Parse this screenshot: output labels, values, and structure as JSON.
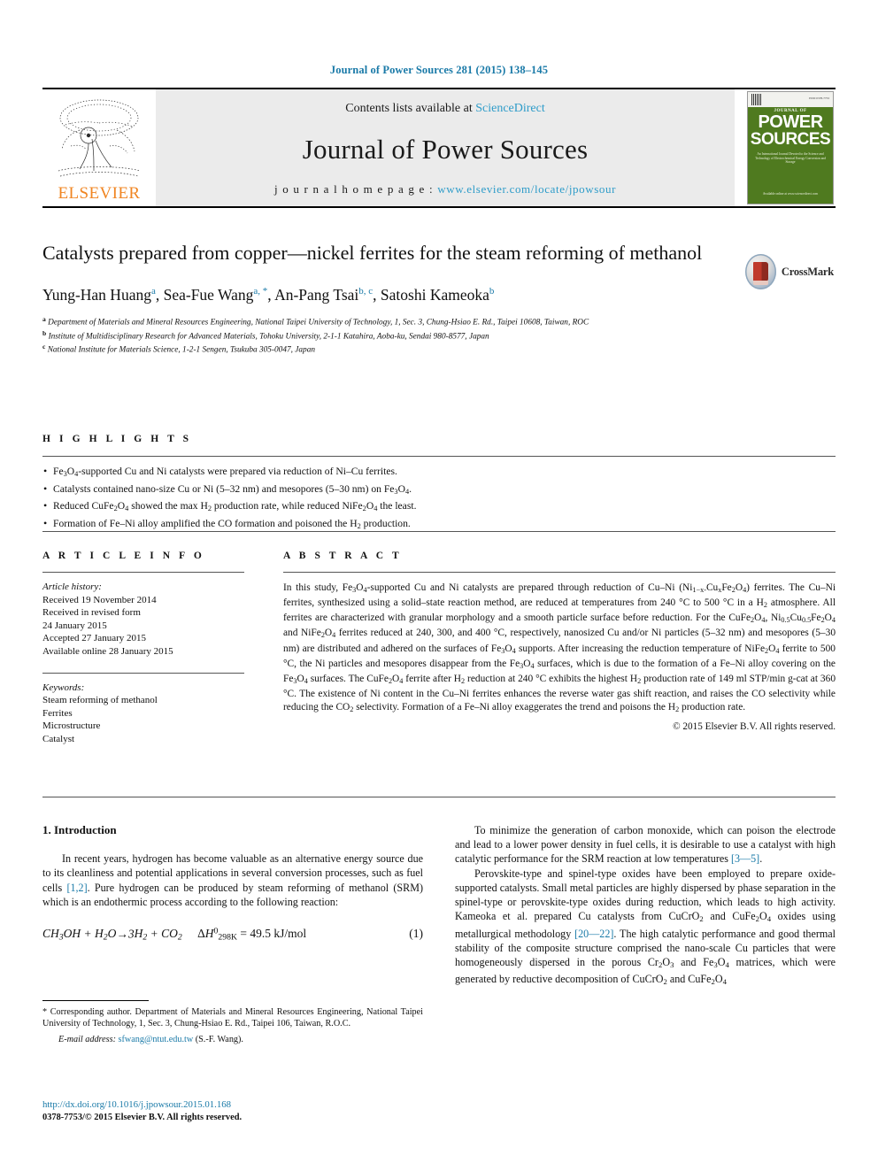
{
  "running_head": "Journal of Power Sources 281 (2015) 138–145",
  "masthead": {
    "contents_prefix": "Contents lists available at ",
    "sciencedirect": "ScienceDirect",
    "journal_name": "Journal of Power Sources",
    "homepage_label": "j o u r n a l   h o m e p a g e :   ",
    "homepage_url": "www.elsevier.com/locate/jpowsour",
    "publisher": "ELSEVIER",
    "cover": {
      "journal_of": "JOURNAL OF",
      "power": "POWER",
      "sources": "SOURCES",
      "blurb": "An International Journal Devoted to the Science and Technology of Electrochemical Energy Conversion and Storage",
      "foot": "Available online at www.sciencedirect.com"
    }
  },
  "article": {
    "title": "Catalysts prepared from copper—nickel ferrites for the steam reforming of methanol",
    "crossmark_label": "CrossMark",
    "authors": [
      {
        "name": "Yung-Han Huang",
        "marks": "a"
      },
      {
        "name": "Sea-Fue Wang",
        "marks": "a, *"
      },
      {
        "name": "An-Pang Tsai",
        "marks": "b, c"
      },
      {
        "name": "Satoshi Kameoka",
        "marks": "b"
      }
    ],
    "affiliations": [
      {
        "mark": "a",
        "text": "Department of Materials and Mineral Resources Engineering, National Taipei University of Technology, 1, Sec. 3, Chung-Hsiao E. Rd., Taipei 10608, Taiwan, ROC"
      },
      {
        "mark": "b",
        "text": "Institute of Multidisciplinary Research for Advanced Materials, Tohoku University, 2-1-1 Katahira, Aoba-ku, Sendai 980-8577, Japan"
      },
      {
        "mark": "c",
        "text": "National Institute for Materials Science, 1-2-1 Sengen, Tsukuba 305-0047, Japan"
      }
    ]
  },
  "highlights": {
    "heading": "H I G H L I G H T S",
    "items": [
      "Fe3O4-supported Cu and Ni catalysts were prepared via reduction of Ni—Cu ferrites.",
      "Catalysts contained nano-size Cu or Ni (5—32 nm) and mesopores (5—30 nm) on Fe3O4.",
      "Reduced CuFe2O4 showed the max H2 production rate, while reduced NiFe2O4 the least.",
      "Formation of Fe—Ni alloy amplified the CO formation and poisoned the H2 production."
    ]
  },
  "article_info": {
    "heading": "A R T I C L E   I N F O",
    "history_label": "Article history:",
    "history": [
      "Received 19 November 2014",
      "Received in revised form",
      "24 January 2015",
      "Accepted 27 January 2015",
      "Available online 28 January 2015"
    ],
    "keywords_label": "Keywords:",
    "keywords": [
      "Steam reforming of methanol",
      "Ferrites",
      "Microstructure",
      "Catalyst"
    ]
  },
  "abstract": {
    "heading": "A B S T R A C T",
    "text_parts": {
      "p1": "In this study, Fe3O4-supported Cu and Ni catalysts are prepared through reduction of Cu—Ni (Ni1−x-CuxFe2O4) ferrites. The Cu—Ni ferrites, synthesized using a solid—state reaction method, are reduced at temperatures from 240 °C to 500 °C in a H2 atmosphere. All ferrites are characterized with granular morphology and a smooth particle surface before reduction. For the CuFe2O4, Ni0.5Cu0.5Fe2O4 and NiFe2O4 ferrites reduced at 240, 300, and 400 °C, respectively, nanosized Cu and/or Ni particles (5—32 nm) and mesopores (5—30 nm) are distributed and adhered on the surfaces of Fe3O4 supports. After increasing the reduction temperature of NiFe2O4 ferrite to 500 °C, the Ni particles and mesopores disappear from the Fe3O4 surfaces, which is due to the formation of a Fe—Ni alloy covering on the Fe3O4 surfaces. The CuFe2O4 ferrite after H2 reduction at 240 °C exhibits the highest H2 production rate of 149 ml STP/min g-cat at 360 °C. The existence of Ni content in the Cu—Ni ferrites enhances the reverse water gas shift reaction, and raises the CO selectivity while reducing the CO2 selectivity. Formation of a Fe—Ni alloy exaggerates the trend and poisons the H2 production rate."
    },
    "copyright": "© 2015 Elsevier B.V. All rights reserved."
  },
  "introduction": {
    "section_number_title": "1.  Introduction",
    "left_paragraphs": [
      "In recent years, hydrogen has become valuable as an alternative energy source due to its cleanliness and potential applications in several conversion processes, such as fuel cells [1,2]. Pure hydrogen can be produced by steam reforming of methanol (SRM) which is an endothermic process according to the following reaction:"
    ],
    "left_refs": [
      "[1,2]"
    ],
    "equation": {
      "lhs": "CH3OH + H2O → 3H2 + CO2",
      "delta": "ΔH0298K = 49.5 kJ/mol",
      "number": "(1)"
    },
    "right_paragraphs": [
      "To minimize the generation of carbon monoxide, which can poison the electrode and lead to a lower power density in fuel cells, it is desirable to use a catalyst with high catalytic performance for the SRM reaction at low temperatures [3—5].",
      "Perovskite-type and spinel-type oxides have been employed to prepare oxide-supported catalysts. Small metal particles are highly dispersed by phase separation in the spinel-type or perovskite-type oxides during reduction, which leads to high activity. Kameoka et al. prepared Cu catalysts from CuCrO2 and CuFe2O4 oxides using metallurgical methodology [20—22]. The high catalytic performance and good thermal stability of the composite structure comprised the nano-scale Cu particles that were homogeneously dispersed in the porous Cr2O3 and Fe3O4 matrices, which were generated by reductive decomposition of CuCrO2 and CuFe2O4"
    ],
    "right_refs": [
      "[3—5]",
      "[20—22]"
    ]
  },
  "footnote": {
    "corresponding": "* Corresponding author. Department of Materials and Mineral Resources Engineering, National Taipei University of Technology, 1, Sec. 3, Chung-Hsiao E. Rd., Taipei 106, Taiwan, R.O.C.",
    "email_label": "E-mail address:",
    "email": "sfwang@ntut.edu.tw",
    "email_suffix": "(S.-F. Wang)."
  },
  "footer": {
    "doi": "http://dx.doi.org/10.1016/j.jpowsour.2015.01.168",
    "issn_line": "0378-7753/© 2015 Elsevier B.V. All rights reserved."
  },
  "colors": {
    "link_blue": "#1a7aa8",
    "sciencedirect_blue": "#2e9cc9",
    "elsevier_orange": "#f08522",
    "cover_green": "#4f7a1f"
  }
}
